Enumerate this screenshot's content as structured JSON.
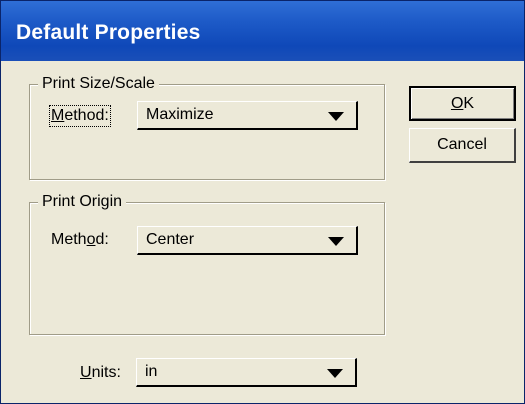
{
  "window": {
    "title": "Default Properties"
  },
  "print_size_scale": {
    "group_label": "Print Size/Scale",
    "method_label_pre": "",
    "method_label_mnemonic": "M",
    "method_label_post": "ethod:",
    "method_value": "Maximize"
  },
  "print_origin": {
    "group_label": "Print Origin",
    "method_label_pre": "Meth",
    "method_label_mnemonic": "o",
    "method_label_post": "d:",
    "method_value": "Center"
  },
  "units": {
    "label_mnemonic": "U",
    "label_post": "nits:",
    "value": "in"
  },
  "buttons": {
    "ok_mnemonic": "O",
    "ok_post": "K",
    "cancel": "Cancel"
  }
}
